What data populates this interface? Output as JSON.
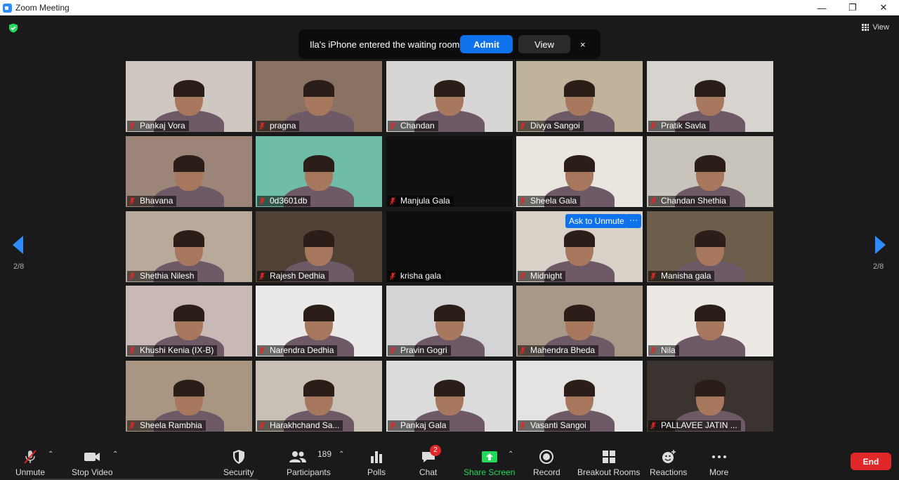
{
  "window": {
    "title": "Zoom Meeting",
    "controls": [
      "—",
      "❐",
      "✕"
    ]
  },
  "view_button": {
    "label": "View"
  },
  "notification": {
    "text": "Ila's iPhone entered the waiting room",
    "admit_label": "Admit",
    "view_label": "View",
    "close_label": "×"
  },
  "pagination": {
    "left": "2/8",
    "right": "2/8"
  },
  "participants": [
    {
      "name": "Pankaj Vora",
      "bg": "#cfc8c0"
    },
    {
      "name": "pragna",
      "bg": "#8a7262"
    },
    {
      "name": "Chandan",
      "bg": "#d8d6d4"
    },
    {
      "name": "Divya Sangoi",
      "bg": "#bfb39c"
    },
    {
      "name": "Pratik Savla",
      "bg": "#d7d4cf"
    },
    {
      "name": "Bhavana",
      "bg": "#9c8478"
    },
    {
      "name": "0d3601db",
      "bg": "#6fbca8"
    },
    {
      "name": "Manjula Gala",
      "bg": "#101010"
    },
    {
      "name": "Sheela Gala",
      "bg": "#e9e6df"
    },
    {
      "name": "Chandan Shethia",
      "bg": "#c9c4bb"
    },
    {
      "name": "Shethia Nilesh",
      "bg": "#b9a99a"
    },
    {
      "name": "Rajesh Dedhia",
      "bg": "#504236"
    },
    {
      "name": "krisha gala",
      "bg": "#0e0e0e"
    },
    {
      "name": "Midnight",
      "bg": "#d9d2c9"
    },
    {
      "name": "Manisha gala",
      "bg": "#6d5e4c"
    },
    {
      "name": "Khushi Kenia (IX-B)",
      "bg": "#c9b9b6"
    },
    {
      "name": "Narendra Dedhia",
      "bg": "#ebe9e7"
    },
    {
      "name": "Pravin Gogri",
      "bg": "#d4d4d6"
    },
    {
      "name": "Mahendra Bheda",
      "bg": "#a99888"
    },
    {
      "name": "Nila",
      "bg": "#ece8e4"
    },
    {
      "name": "Sheela Rambhia",
      "bg": "#a89682"
    },
    {
      "name": "Harakhchand Sa...",
      "bg": "#c8c0b4"
    },
    {
      "name": "Pankaj Gala",
      "bg": "#dcdcdc"
    },
    {
      "name": "Vasanti Sangoi",
      "bg": "#e4e3e1"
    },
    {
      "name": "PALLAVEE JATIN ...",
      "bg": "#3b3330"
    }
  ],
  "ask_to_unmute": {
    "label": "Ask to Unmute",
    "more": "···"
  },
  "toolbar": {
    "unmute": "Unmute",
    "stop_video": "Stop Video",
    "security": "Security",
    "participants": "Participants",
    "participants_count": "189",
    "polls": "Polls",
    "chat": "Chat",
    "chat_badge": "2",
    "share_screen": "Share Screen",
    "record": "Record",
    "breakout_rooms": "Breakout Rooms",
    "reactions": "Reactions",
    "more": "More",
    "end": "End"
  },
  "colors": {
    "accent_blue": "#0e72ed",
    "end_red": "#e02828",
    "share_green": "#23d959",
    "mute_red": "#e02828"
  }
}
